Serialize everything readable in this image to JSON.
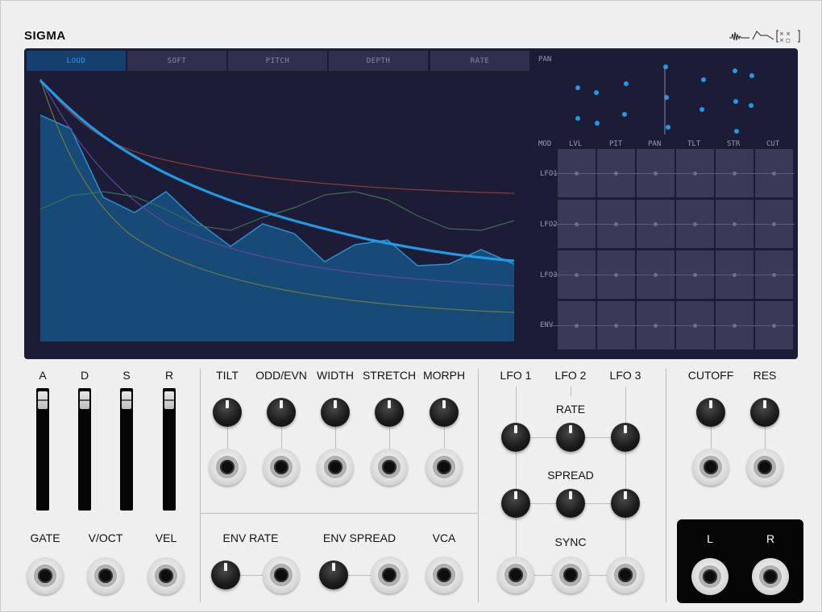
{
  "app": {
    "title": "SIGMA"
  },
  "icons": {
    "logo": [
      "waveform-icon",
      "envelope-icon",
      "matrix-icon"
    ]
  },
  "colors": {
    "accent": "#1e9be6",
    "screen": "#1c1c36"
  },
  "tabs": [
    {
      "label": "LOUD",
      "active": true
    },
    {
      "label": "SOFT",
      "active": false
    },
    {
      "label": "PITCH",
      "active": false
    },
    {
      "label": "DEPTH",
      "active": false
    },
    {
      "label": "RATE",
      "active": false
    }
  ],
  "pan": {
    "label": "PAN"
  },
  "mod_matrix": {
    "corner": "MOD",
    "columns": [
      "LVL",
      "PIT",
      "PAN",
      "TLT",
      "STR",
      "CUT"
    ],
    "rows": [
      "LFO1",
      "LFO2",
      "LFO3",
      "ENV"
    ]
  },
  "adsr": {
    "labels": [
      "A",
      "D",
      "S",
      "R"
    ]
  },
  "gate_row": {
    "labels": [
      "GATE",
      "V/OCT",
      "VEL"
    ]
  },
  "shape": {
    "labels": [
      "TILT",
      "ODD/EVN",
      "WIDTH",
      "STRETCH",
      "MORPH"
    ]
  },
  "env": {
    "rate": "ENV RATE",
    "spread": "ENV SPREAD",
    "vca": "VCA"
  },
  "lfo": {
    "labels": [
      "LFO 1",
      "LFO 2",
      "LFO 3"
    ],
    "rate": "RATE",
    "spread": "SPREAD",
    "sync": "SYNC"
  },
  "filter": {
    "cutoff": "CUTOFF",
    "res": "RES"
  },
  "output": {
    "left": "L",
    "right": "R"
  }
}
